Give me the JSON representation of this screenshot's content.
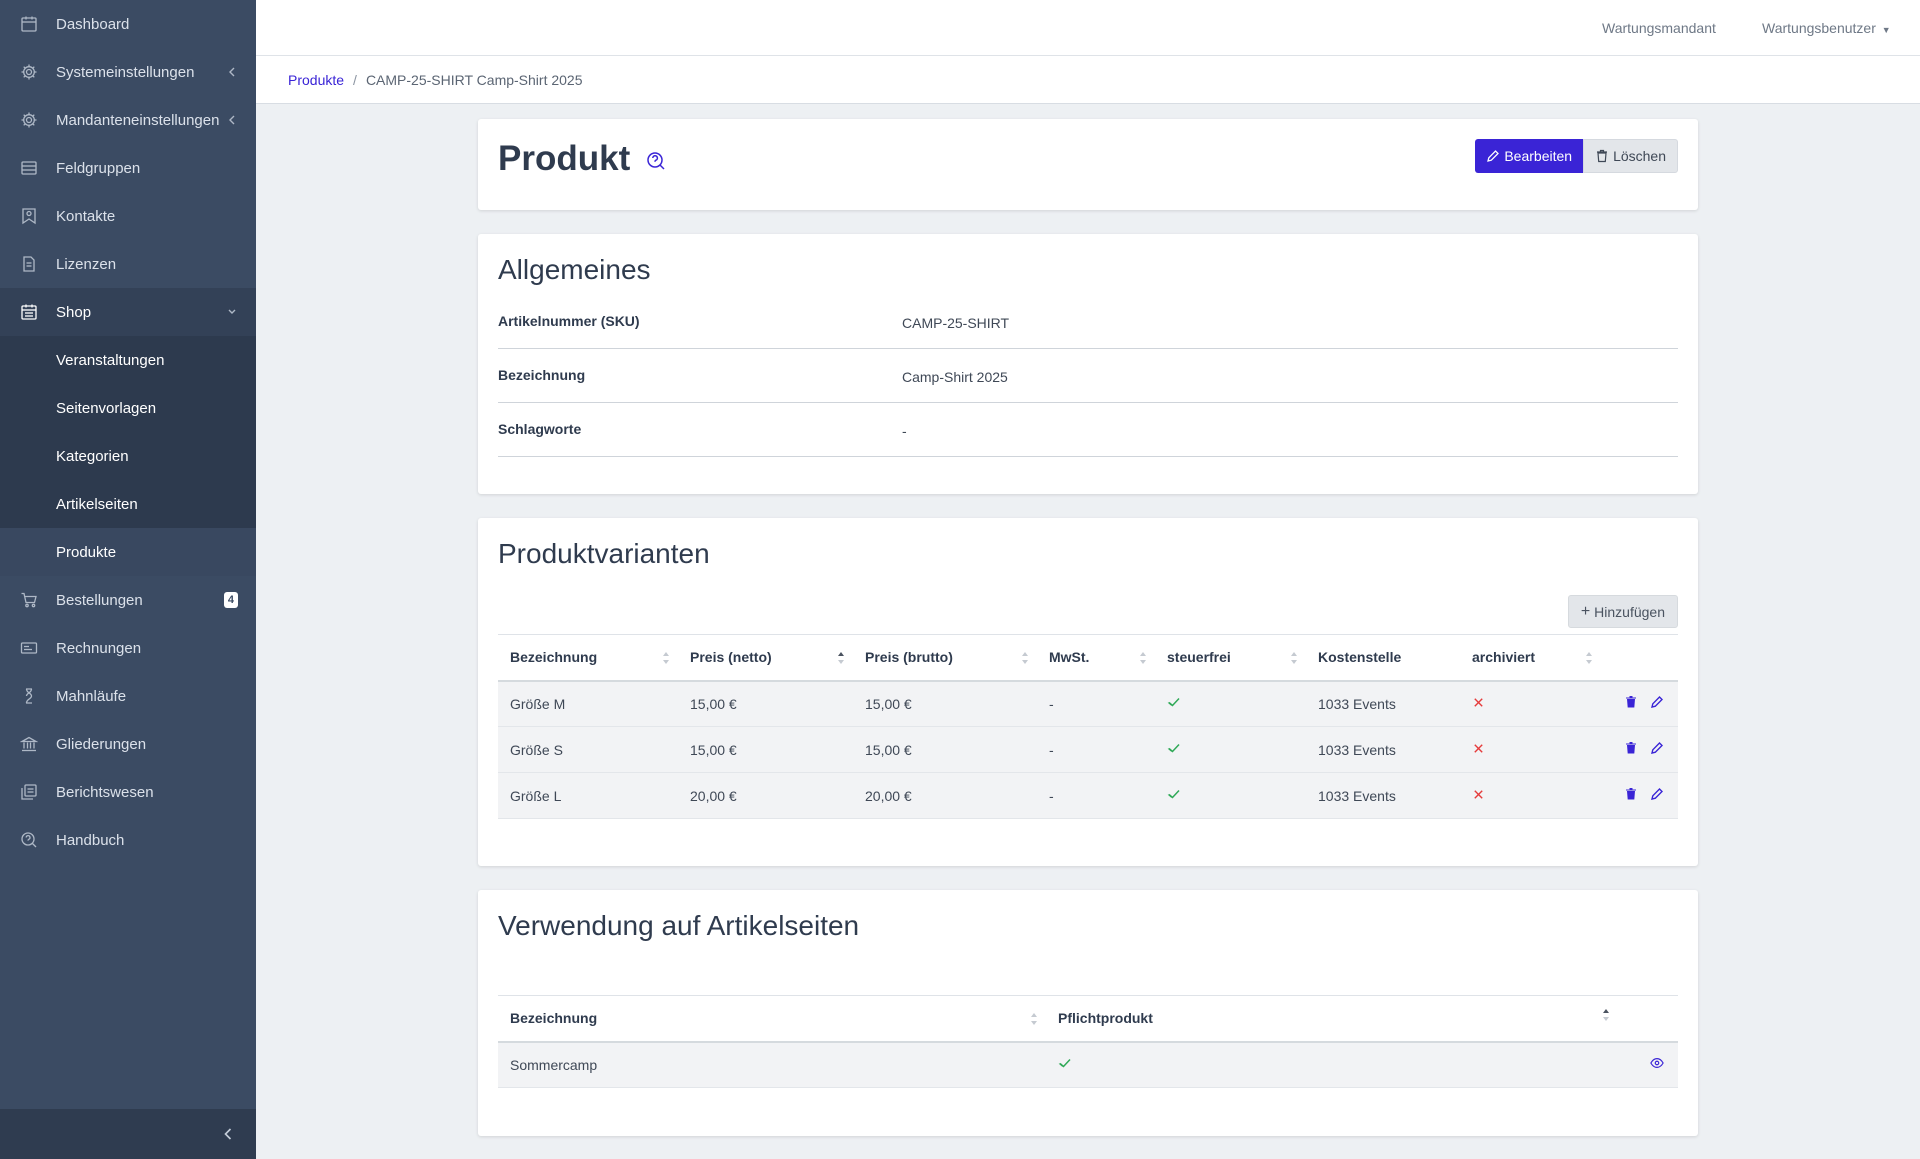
{
  "header": {
    "tenant": "Wartungsmandant",
    "user": "Wartungsbenutzer"
  },
  "breadcrumb": {
    "parent": "Produkte",
    "separator": "/",
    "current": "CAMP-25-SHIRT Camp-Shirt 2025"
  },
  "sidebar": {
    "items": [
      {
        "label": "Dashboard",
        "icon": "calendar-icon"
      },
      {
        "label": "Systemeinstellungen",
        "icon": "gear-icon"
      },
      {
        "label": "Mandanteneinstellungen",
        "icon": "gear-icon"
      },
      {
        "label": "Feldgruppen",
        "icon": "list-icon"
      },
      {
        "label": "Kontakte",
        "icon": "contacts-icon"
      },
      {
        "label": "Lizenzen",
        "icon": "document-icon"
      },
      {
        "label": "Shop",
        "icon": "calendar-icon"
      }
    ],
    "shop_sub": [
      {
        "label": "Veranstaltungen"
      },
      {
        "label": "Seitenvorlagen"
      },
      {
        "label": "Kategorien"
      },
      {
        "label": "Artikelseiten"
      },
      {
        "label": "Produkte"
      }
    ],
    "items_after": [
      {
        "label": "Bestellungen",
        "icon": "cart-icon",
        "badge": "4"
      },
      {
        "label": "Rechnungen",
        "icon": "invoice-icon"
      },
      {
        "label": "Mahnläufe",
        "icon": "hourglass-icon"
      },
      {
        "label": "Gliederungen",
        "icon": "bank-icon"
      },
      {
        "label": "Berichtswesen",
        "icon": "reports-icon"
      },
      {
        "label": "Handbuch",
        "icon": "help-icon"
      }
    ]
  },
  "product": {
    "title": "Produkt",
    "edit_label": "Bearbeiten",
    "delete_label": "Löschen"
  },
  "general": {
    "title": "Allgemeines",
    "rows": [
      {
        "key": "Artikelnummer (SKU)",
        "value": "CAMP-25-SHIRT"
      },
      {
        "key": "Bezeichnung",
        "value": "Camp-Shirt 2025"
      },
      {
        "key": "Schlagworte",
        "value": "-"
      }
    ]
  },
  "variants": {
    "title": "Produktvarianten",
    "add_label": "Hinzufügen",
    "columns": [
      "Bezeichnung",
      "Preis (netto)",
      "Preis (brutto)",
      "MwSt.",
      "steuerfrei",
      "Kostenstelle",
      "archiviert"
    ],
    "rows": [
      {
        "name": "Größe M",
        "netto": "15,00 €",
        "brutto": "15,00 €",
        "mwst": "-",
        "cost": "1033 Events"
      },
      {
        "name": "Größe S",
        "netto": "15,00 €",
        "brutto": "15,00 €",
        "mwst": "-",
        "cost": "1033 Events"
      },
      {
        "name": "Größe L",
        "netto": "20,00 €",
        "brutto": "20,00 €",
        "mwst": "-",
        "cost": "1033 Events"
      }
    ]
  },
  "usage": {
    "title": "Verwendung auf Artikelseiten",
    "columns": [
      "Bezeichnung",
      "Pflichtprodukt"
    ],
    "rows": [
      {
        "name": "Sommercamp"
      }
    ]
  },
  "colors": {
    "accent": "#3a24d6",
    "sidebar": "#3b4b63",
    "success": "#2fa957",
    "danger": "#e53b3b"
  }
}
